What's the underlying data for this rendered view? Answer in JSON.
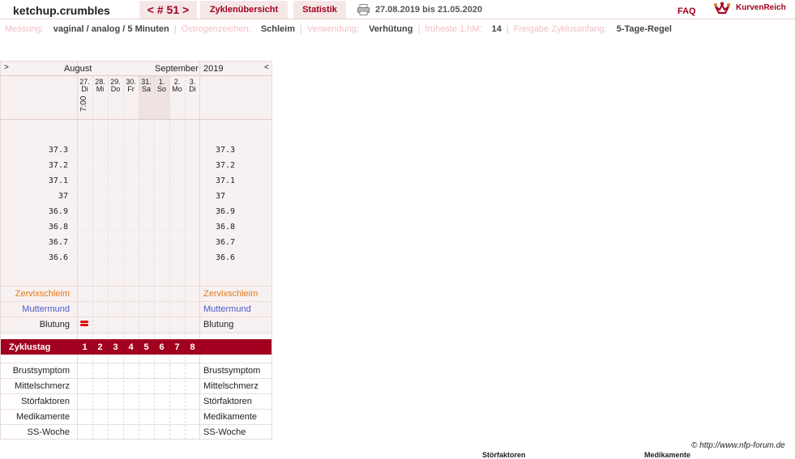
{
  "header": {
    "username": "ketchup.crumbles",
    "cycle_tab": "< # 51 >",
    "overview_tab": "Zyklenübersicht",
    "stats_tab": "Statistik",
    "date_range": "27.08.2019 bis 21.05.2020",
    "faq": "FAQ",
    "brand": "KurvenReich"
  },
  "info": [
    {
      "label": "Messung:",
      "value": "vaginal / analog / 5 Minuten"
    },
    {
      "label": "Östrogenzeichen:",
      "value": "Schleim"
    },
    {
      "label": "Verwendung:",
      "value": "Verhütung"
    },
    {
      "label": "früheste 1.hM:",
      "value": "14"
    },
    {
      "label": "Freigabe Zyklusanfang:",
      "value": "5-Tage-Regel"
    }
  ],
  "chart": {
    "nav_left": ">",
    "nav_right": "<",
    "month1": "August",
    "month2": "September",
    "year": "2019",
    "time": "7:00",
    "days": [
      {
        "date": "27.",
        "dow": "Di",
        "weekend": false
      },
      {
        "date": "28.",
        "dow": "Mi",
        "weekend": false
      },
      {
        "date": "29.",
        "dow": "Do",
        "weekend": false
      },
      {
        "date": "30.",
        "dow": "Fr",
        "weekend": false
      },
      {
        "date": "31.",
        "dow": "Sa",
        "weekend": true
      },
      {
        "date": "1.",
        "dow": "So",
        "weekend": true
      },
      {
        "date": "2.",
        "dow": "Mo",
        "weekend": false
      },
      {
        "date": "3.",
        "dow": "Di",
        "weekend": false
      }
    ],
    "temps": [
      "37.3",
      "37.2",
      "37.1",
      "37",
      "36.9",
      "36.8",
      "36.7",
      "36.6"
    ],
    "rows_top": [
      {
        "label": "Zervixschleim",
        "color": "#e07a1a"
      },
      {
        "label": "Muttermund",
        "color": "#4a5acd"
      },
      {
        "label": "Blutung",
        "color": "#222222"
      }
    ],
    "cycle_label": "Zyklustag",
    "cycle_days": [
      "1",
      "2",
      "3",
      "4",
      "5",
      "6",
      "7",
      "8"
    ],
    "rows_bottom": [
      "Brustsymptom",
      "Mittelschmerz",
      "Störfaktoren",
      "Medikamente",
      "SS-Woche"
    ],
    "bleeding_day_index": 0
  },
  "footer": {
    "copyright": "© http://www.nfp-forum.de",
    "col1": "Störfaktoren",
    "col2": "Medikamente"
  },
  "colors": {
    "accent": "#a1001e",
    "tab_bg": "#f6e7e7",
    "chart_bg": "#f8f1f1",
    "weekend_bg": "#efe2e2"
  }
}
